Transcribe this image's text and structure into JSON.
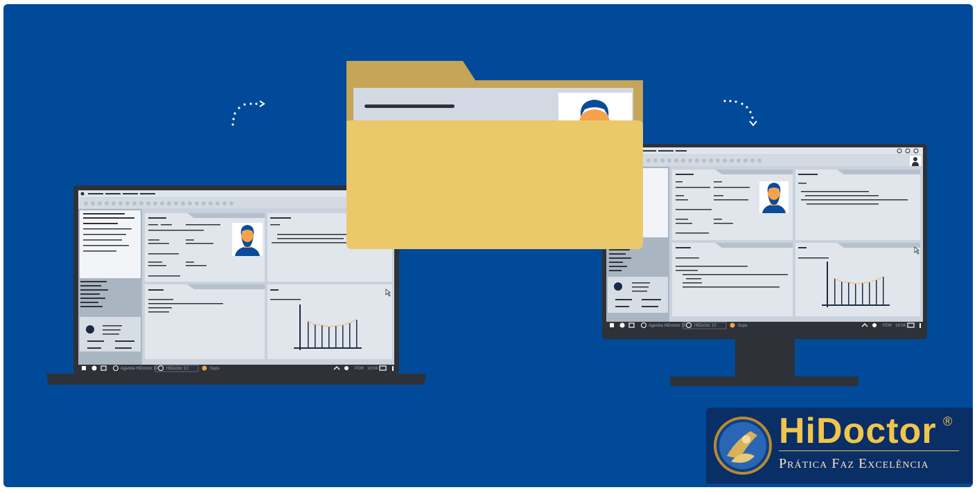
{
  "taskbar": {
    "items": [
      "Agenda HiDoctor 10",
      "HiDoctor 10",
      "Sups"
    ],
    "language": "POR",
    "time": "16:04"
  },
  "brand": {
    "name": "HiDoctor",
    "registered": "®",
    "tagline": "Prática Faz Excelência"
  },
  "icons": [
    "windows-icon",
    "folder-icon",
    "avatar-icon",
    "chart-icon",
    "cursor-icon"
  ],
  "colors": {
    "background": "#004a99",
    "device": "#2e3138",
    "screen": "#c9d2dc",
    "folder": "#ebc96b",
    "folder_back": "#c6a458",
    "brand_gold": "#f1c54b",
    "avatar_hair": "#0a4c9a",
    "avatar_skin": "#f5a24a"
  }
}
